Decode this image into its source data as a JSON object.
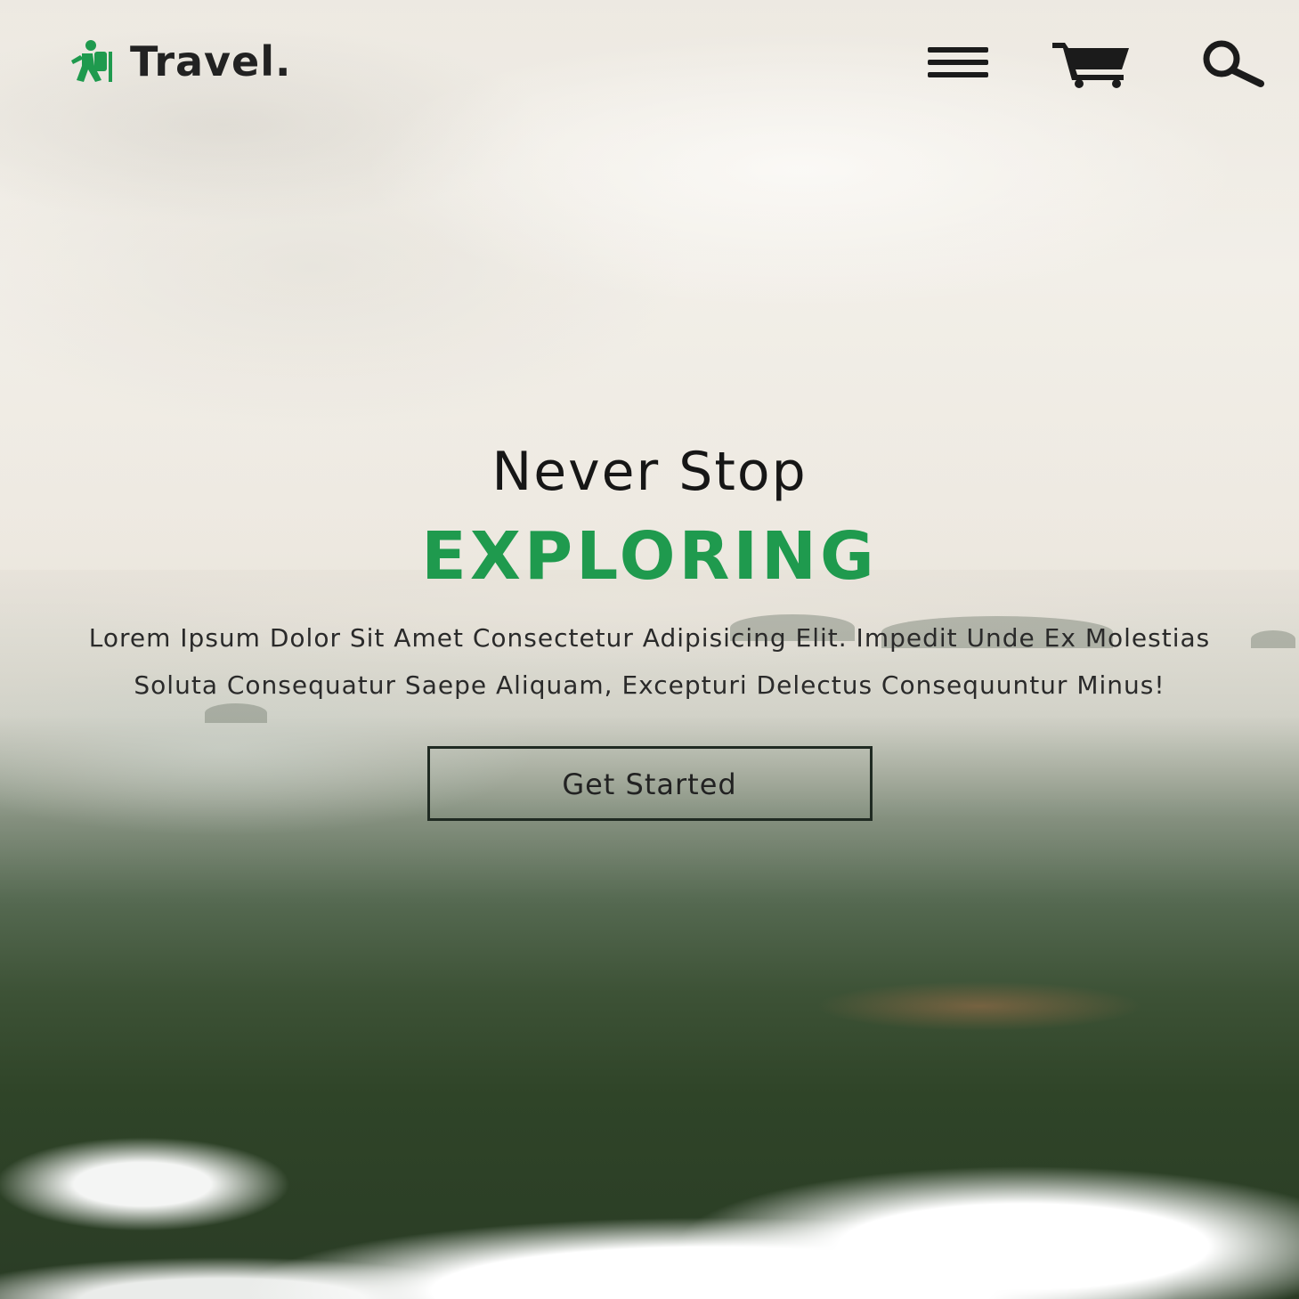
{
  "header": {
    "logo_text": "Travel.",
    "logo_icon": "hiking-person-icon",
    "menu_icon": "hamburger-menu-icon",
    "cart_icon": "shopping-cart-icon",
    "search_icon": "search-icon"
  },
  "hero": {
    "title": "Never Stop",
    "highlight": "EXPLORING",
    "description": "Lorem Ipsum Dolor Sit Amet Consectetur Adipisicing Elit. Impedit Unde Ex Molestias Soluta Consequatur Saepe Aliquam, Excepturi Delectus Consequuntur Minus!",
    "cta_label": "Get Started"
  },
  "colors": {
    "accent": "#1f9a4e",
    "text_dark": "#161616",
    "button_border": "#1f2a22"
  }
}
